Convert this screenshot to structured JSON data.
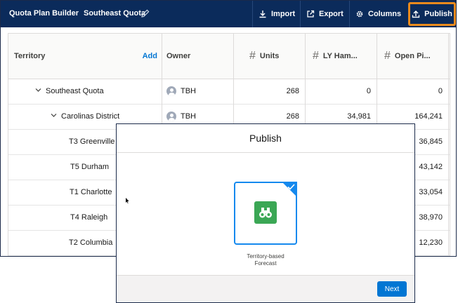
{
  "topbar": {
    "app_title": "Quota Plan Builder",
    "plan_name": "Southeast Quota",
    "import_label": "Import",
    "export_label": "Export",
    "columns_label": "Columns",
    "publish_label": "Publish"
  },
  "grid": {
    "columns": {
      "territory": "Territory",
      "add_label": "Add",
      "owner": "Owner",
      "units": "Units",
      "ly_ham": "LY Ham...",
      "open_pi": "Open Pi..."
    },
    "rows": [
      {
        "territory": "Southeast Quota",
        "level": 1,
        "expanded": true,
        "owner": "TBH",
        "units": "268",
        "ly": "0",
        "open": "0"
      },
      {
        "territory": "Carolinas District",
        "level": 2,
        "expanded": true,
        "owner": "TBH",
        "units": "268",
        "ly": "34,981",
        "open": "164,241"
      },
      {
        "territory": "T3 Greenville",
        "level": 3,
        "open": "36,845"
      },
      {
        "territory": "T5 Durham",
        "level": 3,
        "open": "43,142"
      },
      {
        "territory": "T1 Charlotte",
        "level": 3,
        "open": "33,054"
      },
      {
        "territory": "T4 Raleigh",
        "level": 3,
        "open": "38,970"
      },
      {
        "territory": "T2 Columbia",
        "level": 3,
        "open": "12,230"
      }
    ]
  },
  "modal": {
    "title": "Publish",
    "option_label_line1": "Territory-based",
    "option_label_line2": "Forecast",
    "option_icon": "binoculars-icon",
    "option_selected": true,
    "next_label": "Next"
  },
  "colors": {
    "topbar": "#0b2b5b",
    "publish_highlight": "#e98a1d",
    "selection": "#1589ee",
    "option_icon_bg": "#3ba755",
    "primary_button": "#0176d3"
  }
}
